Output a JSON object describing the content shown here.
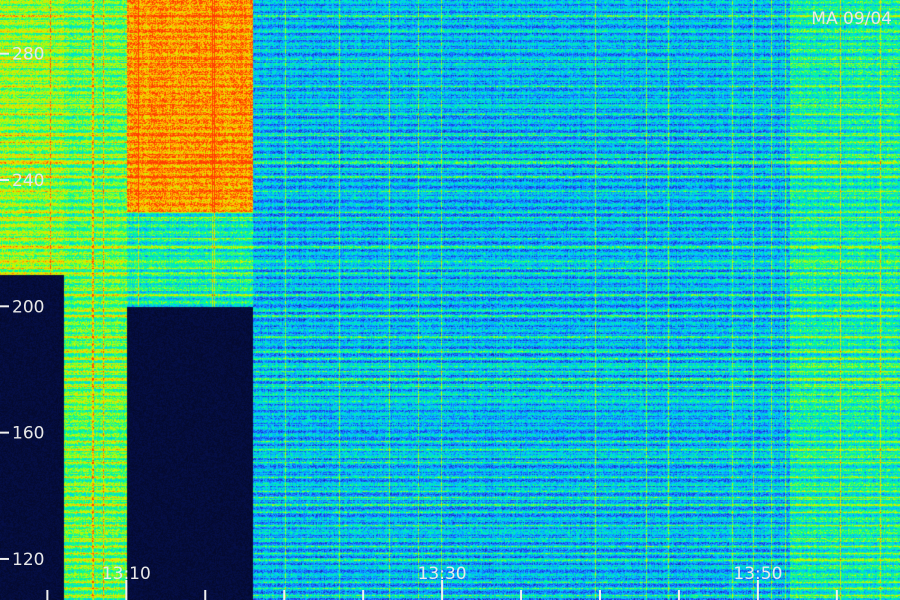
{
  "chart_data": {
    "type": "heatmap",
    "title": "MA 09/04",
    "xlabel": "",
    "ylabel": "",
    "x_tick_labels": [
      "13:10",
      "13:30",
      "13:50"
    ],
    "x_tick_minutes": [
      10,
      30,
      50
    ],
    "x_range_minutes": [
      2,
      59
    ],
    "x_minor_tick_interval_minutes": 5,
    "y_ticks": [
      120,
      160,
      200,
      240,
      280
    ],
    "y_range": [
      107,
      297
    ],
    "grid": false,
    "colormap": [
      "#000000",
      "#0a1a7a",
      "#1e50ff",
      "#00c8ff",
      "#00ff90",
      "#b8ff00",
      "#ffd000",
      "#ff3c00"
    ],
    "intensity_zones": [
      {
        "t_start": 2,
        "t_end": 6,
        "f_min": 210,
        "f_max": 297,
        "level": 0.55
      },
      {
        "t_start": 6,
        "t_end": 10,
        "f_min": 107,
        "f_max": 297,
        "level": 0.5
      },
      {
        "t_start": 10,
        "t_end": 18,
        "f_min": 230,
        "f_max": 297,
        "level": 0.82
      },
      {
        "t_start": 10,
        "t_end": 18,
        "f_min": 200,
        "f_max": 230,
        "level": 0.4
      },
      {
        "t_start": 18,
        "t_end": 59,
        "f_min": 107,
        "f_max": 297,
        "level": 0.28
      },
      {
        "t_start": 52,
        "t_end": 59,
        "f_min": 107,
        "f_max": 297,
        "level": 0.4
      }
    ]
  }
}
